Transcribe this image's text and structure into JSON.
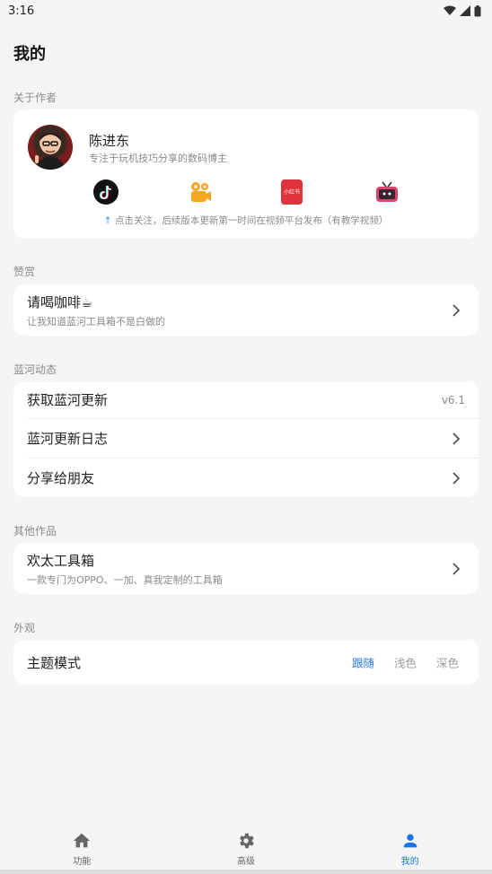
{
  "status_bar": {
    "time": "3:16"
  },
  "page_title": "我的",
  "about": {
    "section_label": "关于作者",
    "author_name": "陈进东",
    "author_desc": "专注于玩机技巧分享的数码博主",
    "platforms": [
      {
        "icon": "tiktok-icon",
        "color": "#111111"
      },
      {
        "icon": "kuaishou-icon",
        "color": "#f5a623"
      },
      {
        "icon": "xiaohongshu-icon",
        "color": "#e0343c"
      },
      {
        "icon": "bilibili-tv-icon",
        "color": "#d9466f"
      }
    ],
    "platform_text": "小红书",
    "follow_note": "点击关注，后续版本更新第一时间在视频平台发布（有教学视频）"
  },
  "donate": {
    "section_label": "赞赏",
    "title": "请喝咖啡☕",
    "subtitle": "让我知道蓝河工具箱不是白做的"
  },
  "updates": {
    "section_label": "蓝河动态",
    "items": [
      {
        "title": "获取蓝河更新",
        "value": "v6.1"
      },
      {
        "title": "蓝河更新日志"
      },
      {
        "title": "分享给朋友"
      }
    ]
  },
  "other_works": {
    "section_label": "其他作品",
    "title": "欢太工具箱",
    "subtitle": "一款专门为OPPO、一加、真我定制的工具箱"
  },
  "appearance": {
    "section_label": "外观",
    "title": "主题模式",
    "options": [
      "跟随",
      "浅色",
      "深色"
    ],
    "selected": "跟随"
  },
  "colors": {
    "accent": "#2e7cf0",
    "background": "#f5f5f5"
  },
  "bottom_nav": [
    {
      "label": "功能",
      "icon": "home-icon"
    },
    {
      "label": "高级",
      "icon": "gear-icon"
    },
    {
      "label": "我的",
      "icon": "person-icon",
      "active": true
    }
  ]
}
